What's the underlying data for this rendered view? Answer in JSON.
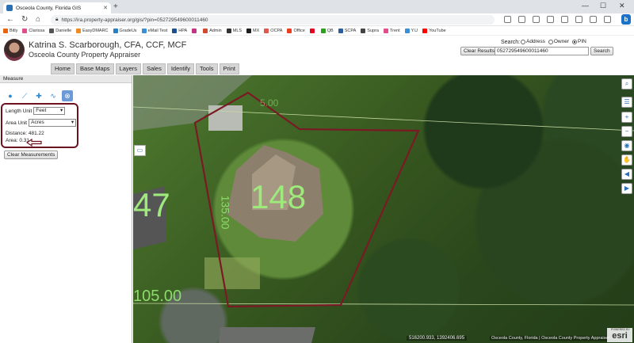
{
  "browser": {
    "tab_title": "Osceola County, Florida GIS",
    "url": "https://ira.property-appraiser.org/gis/?pin=052729549600011460",
    "favorites": [
      {
        "label": "Bitly",
        "color": "#e8640c"
      },
      {
        "label": "Clarissa",
        "color": "#e04d8a"
      },
      {
        "label": "Danielle",
        "color": "#555555"
      },
      {
        "label": "EasyDMARC",
        "color": "#f08a24"
      },
      {
        "label": "GradeUs",
        "color": "#2a7ec1"
      },
      {
        "label": "eMail Test",
        "color": "#3b8fd6"
      },
      {
        "label": "HPA",
        "color": "#1b4f8e"
      },
      {
        "label": "",
        "color": "#c13584"
      },
      {
        "label": "Admin",
        "color": "#d14a2f"
      },
      {
        "label": "MLS",
        "color": "#333333"
      },
      {
        "label": "MX",
        "color": "#1d1d1d"
      },
      {
        "label": "OCPA",
        "color": "#e2574c"
      },
      {
        "label": "Office",
        "color": "#ea3e23"
      },
      {
        "label": "",
        "color": "#e60023"
      },
      {
        "label": "QB",
        "color": "#2ca01c"
      },
      {
        "label": "SCPA",
        "color": "#2b5e9b"
      },
      {
        "label": "Supra",
        "color": "#444444"
      },
      {
        "label": "Trent",
        "color": "#e04d8a"
      },
      {
        "label": "Y.U",
        "color": "#3b8fd6"
      },
      {
        "label": "YouTube",
        "color": "#ff0000"
      }
    ]
  },
  "header": {
    "name": "Katrina S. Scarborough, CFA, CCF, MCF",
    "subtitle": "Osceola County Property Appraiser",
    "search_label": "Search:",
    "search_options": [
      {
        "label": "Address",
        "selected": false
      },
      {
        "label": "Owner",
        "selected": false
      },
      {
        "label": "PIN",
        "selected": true
      }
    ],
    "clear_results": "Clear Results",
    "search_value": "052729549600011460",
    "search_button": "Search",
    "menu": [
      "Home",
      "Base Maps",
      "Layers",
      "Sales",
      "Identify",
      "Tools",
      "Print"
    ]
  },
  "panel": {
    "title": "Measure",
    "length_unit_label": "Length Unit",
    "length_unit_value": "Feet",
    "area_unit_label": "Area Unit",
    "area_unit_value": "Acres",
    "distance_text": "Distance: 481.22",
    "area_text": "Area: 0.31",
    "clear_button": "Clear Measurements"
  },
  "map": {
    "lot_numbers": [
      "47",
      "148"
    ],
    "dimension_labels": [
      "105.00",
      "135.00",
      "5.00",
      "135.00"
    ],
    "coordinates": "516200.933, 1392406.695",
    "attribution": "Osceola County, Florida | Osceola County Property Appraiser",
    "esri_logo": "esri",
    "esri_powered": "POWERED BY",
    "parcel_outline_color": "#7a1a24"
  }
}
